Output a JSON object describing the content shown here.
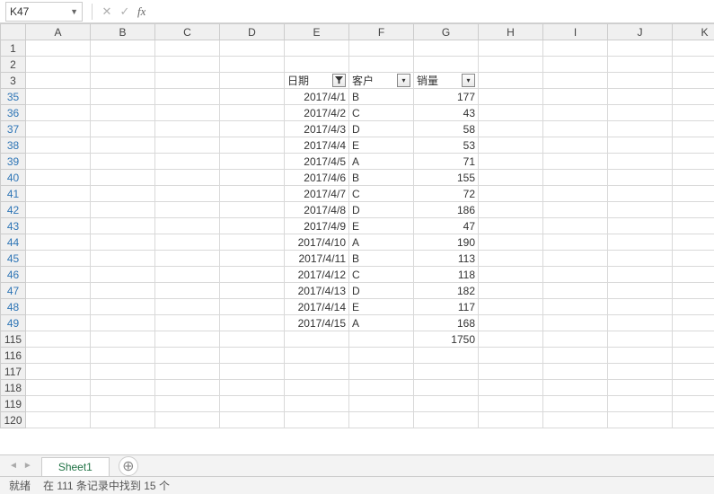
{
  "formula_bar": {
    "name_box": "K47",
    "fx_label": "fx",
    "formula_value": ""
  },
  "columns": [
    "A",
    "B",
    "C",
    "D",
    "E",
    "F",
    "G",
    "H",
    "I",
    "J",
    "K"
  ],
  "row_numbers": [
    1,
    2,
    3,
    35,
    36,
    37,
    38,
    39,
    40,
    41,
    42,
    43,
    44,
    45,
    46,
    47,
    48,
    49,
    115,
    116,
    117,
    118,
    119,
    120
  ],
  "filtered_rows": [
    35,
    36,
    37,
    38,
    39,
    40,
    41,
    42,
    43,
    44,
    45,
    46,
    47,
    48,
    49
  ],
  "headers": {
    "date": "日期",
    "customer": "客户",
    "sales": "销量"
  },
  "chart_data": {
    "type": "table",
    "title": "",
    "columns": [
      "日期",
      "客户",
      "销量"
    ],
    "rows": [
      {
        "日期": "2017/4/1",
        "客户": "B",
        "销量": 177
      },
      {
        "日期": "2017/4/2",
        "客户": "C",
        "销量": 43
      },
      {
        "日期": "2017/4/3",
        "客户": "D",
        "销量": 58
      },
      {
        "日期": "2017/4/4",
        "客户": "E",
        "销量": 53
      },
      {
        "日期": "2017/4/5",
        "客户": "A",
        "销量": 71
      },
      {
        "日期": "2017/4/6",
        "客户": "B",
        "销量": 155
      },
      {
        "日期": "2017/4/7",
        "客户": "C",
        "销量": 72
      },
      {
        "日期": "2017/4/8",
        "客户": "D",
        "销量": 186
      },
      {
        "日期": "2017/4/9",
        "客户": "E",
        "销量": 47
      },
      {
        "日期": "2017/4/10",
        "客户": "A",
        "销量": 190
      },
      {
        "日期": "2017/4/11",
        "客户": "B",
        "销量": 113
      },
      {
        "日期": "2017/4/12",
        "客户": "C",
        "销量": 118
      },
      {
        "日期": "2017/4/13",
        "客户": "D",
        "销量": 182
      },
      {
        "日期": "2017/4/14",
        "客户": "E",
        "销量": 117
      },
      {
        "日期": "2017/4/15",
        "客户": "A",
        "销量": 168
      }
    ],
    "total": 1750
  },
  "sheet_tab": "Sheet1",
  "status": {
    "ready": "就绪",
    "filter_msg": "在 111 条记录中找到 15 个"
  }
}
